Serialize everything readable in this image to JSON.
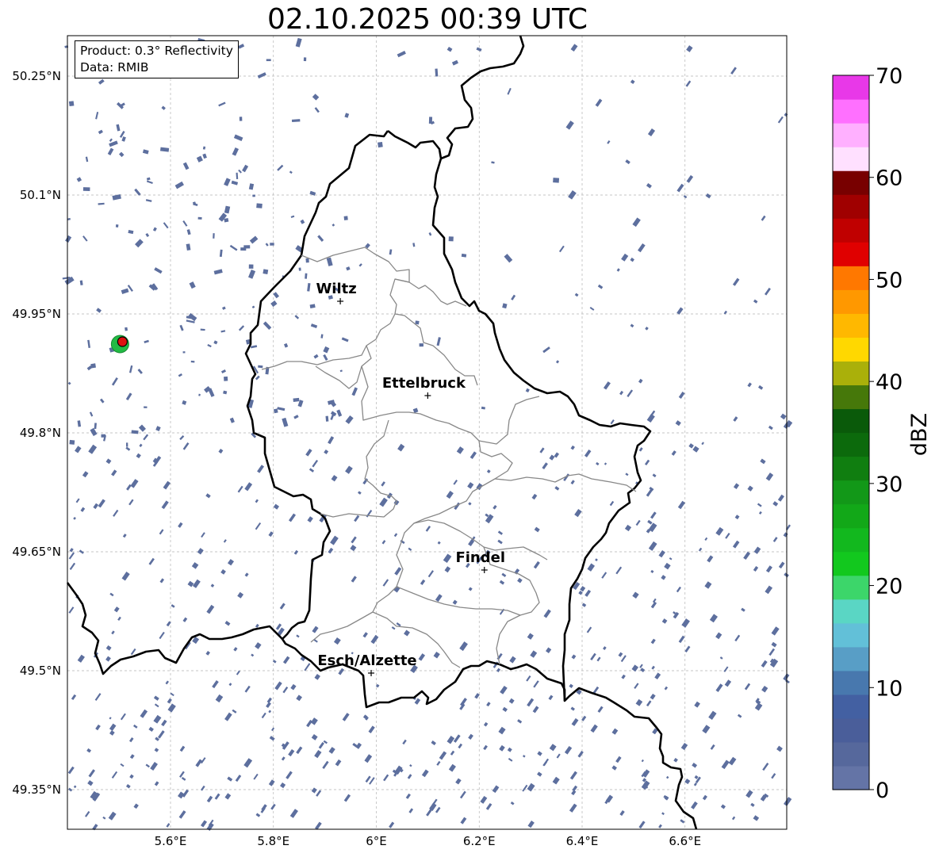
{
  "title": "02.10.2025 00:39 UTC",
  "infobox": {
    "product": "Product: 0.3° Reflectivity",
    "data_source": "Data: RMIB"
  },
  "map": {
    "lon_ticks": [
      {
        "value": 5.6,
        "label": "5.6°E"
      },
      {
        "value": 5.8,
        "label": "5.8°E"
      },
      {
        "value": 6.0,
        "label": "6°E"
      },
      {
        "value": 6.2,
        "label": "6.2°E"
      },
      {
        "value": 6.4,
        "label": "6.4°E"
      },
      {
        "value": 6.6,
        "label": "6.6°E"
      }
    ],
    "lat_ticks": [
      {
        "value": 50.25,
        "label": "50.25°N"
      },
      {
        "value": 50.1,
        "label": "50.1°N"
      },
      {
        "value": 49.95,
        "label": "49.95°N"
      },
      {
        "value": 49.8,
        "label": "49.8°N"
      },
      {
        "value": 49.65,
        "label": "49.65°N"
      },
      {
        "value": 49.5,
        "label": "49.5°N"
      },
      {
        "value": 49.35,
        "label": "49.35°N"
      }
    ],
    "cities": [
      {
        "name": "Wiltz",
        "lon": 5.93,
        "lat": 49.966
      },
      {
        "name": "Ettelbruck",
        "lon": 6.1,
        "lat": 49.847
      },
      {
        "name": "Findel",
        "lon": 6.21,
        "lat": 49.627
      },
      {
        "name": "Esch/Alzette",
        "lon": 5.99,
        "lat": 49.497
      }
    ],
    "radar_site": {
      "lon": 5.505,
      "lat": 49.914
    },
    "colors": {
      "echo": "#5d6f9e",
      "border": "#000000",
      "canton": "#888888",
      "grid": "#b4b4b4",
      "radar_marker": "#dd1111",
      "radar_ring": "#22bb44"
    }
  },
  "colorbar": {
    "label": "dBZ",
    "min": 0,
    "max": 70,
    "ticks": [
      0,
      10,
      20,
      30,
      40,
      50,
      60,
      70
    ],
    "colors": [
      "#6474a6",
      "#56689c",
      "#4a5e9a",
      "#4360a2",
      "#4878ae",
      "#589ec6",
      "#62c0d8",
      "#5ad6c4",
      "#3cd66a",
      "#12c81e",
      "#12b81e",
      "#12a818",
      "#129818",
      "#107e10",
      "#0c6a0c",
      "#0a5a0a",
      "#46780a",
      "#aab00a",
      "#ffd800",
      "#ffb800",
      "#ff9800",
      "#ff7800",
      "#e00000",
      "#c00000",
      "#a00000",
      "#780000",
      "#ffe0ff",
      "#ffb0ff",
      "#ff70ff",
      "#e838e8"
    ]
  }
}
